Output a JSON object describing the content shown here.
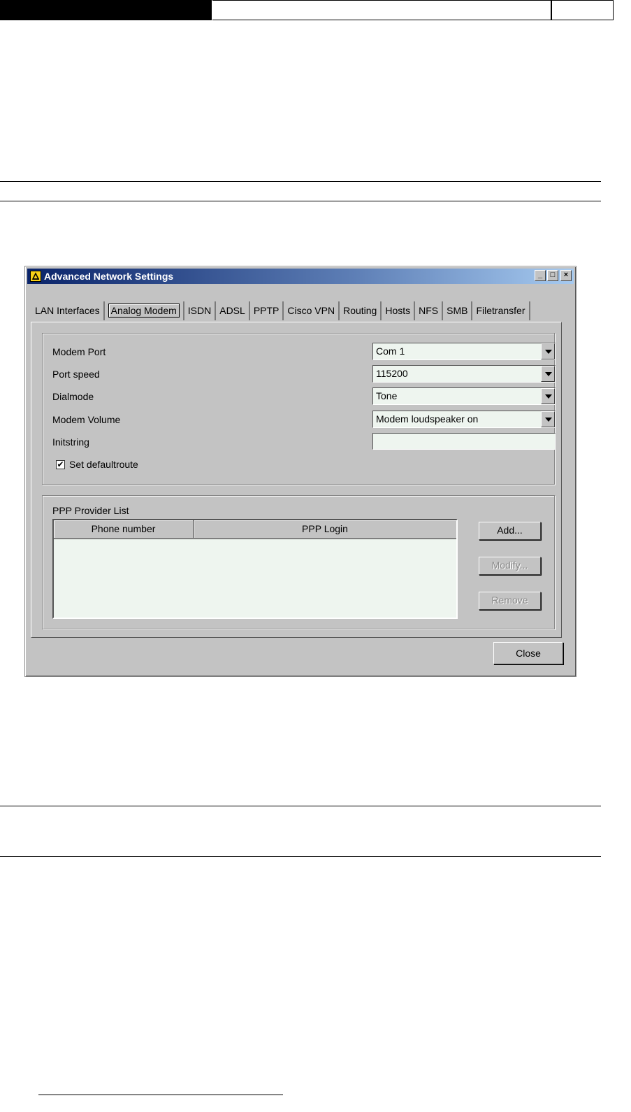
{
  "window": {
    "title": "Advanced Network Settings",
    "minimize_glyph": "_",
    "maximize_glyph": "□",
    "close_glyph": "×"
  },
  "tabs": [
    {
      "label": "LAN Interfaces",
      "active": false
    },
    {
      "label": "Analog Modem",
      "active": true
    },
    {
      "label": "ISDN",
      "active": false
    },
    {
      "label": "ADSL",
      "active": false
    },
    {
      "label": "PPTP",
      "active": false
    },
    {
      "label": "Cisco VPN",
      "active": false
    },
    {
      "label": "Routing",
      "active": false
    },
    {
      "label": "Hosts",
      "active": false
    },
    {
      "label": "NFS",
      "active": false
    },
    {
      "label": "SMB",
      "active": false
    },
    {
      "label": "Filetransfer",
      "active": false
    }
  ],
  "modem": {
    "port_label": "Modem Port",
    "port_value": "Com 1",
    "speed_label": "Port speed",
    "speed_value": "115200",
    "dialmode_label": "Dialmode",
    "dialmode_value": "Tone",
    "volume_label": "Modem Volume",
    "volume_value": "Modem loudspeaker on",
    "initstring_label": "Initstring",
    "initstring_value": "",
    "defaultroute_label": "Set defaultroute",
    "defaultroute_checked": true,
    "check_glyph": "✔"
  },
  "ppp": {
    "title": "PPP Provider List",
    "columns": [
      "Phone number",
      "PPP Login"
    ],
    "rows": [],
    "add_label": "Add...",
    "modify_label": "Modify...",
    "remove_label": "Remove"
  },
  "footer": {
    "close_label": "Close"
  }
}
